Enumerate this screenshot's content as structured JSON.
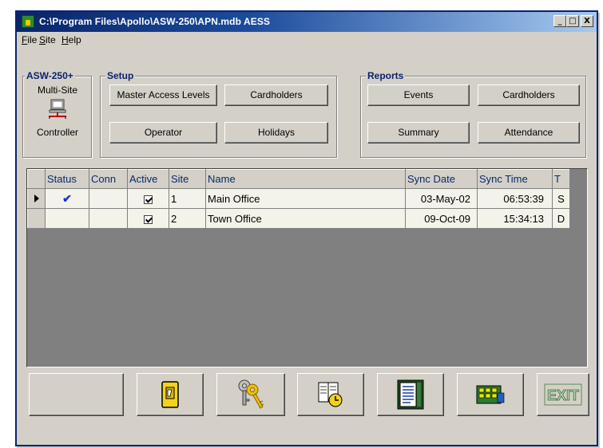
{
  "window": {
    "title": "C:\\Program Files\\Apollo\\ASW-250\\APN.mdb  AESS",
    "minimize": "_",
    "maximize": "□",
    "close": "X"
  },
  "menu": {
    "items": [
      {
        "label": "File",
        "accel": "F",
        "rest": "ile"
      },
      {
        "label": "Site",
        "accel": "S",
        "rest": "ite"
      },
      {
        "label": "Help",
        "accel": "H",
        "rest": "elp"
      }
    ]
  },
  "asw": {
    "title": "ASW-250+",
    "line1": "Multi-Site",
    "line2": "Controller",
    "icon": "computer-network-icon"
  },
  "setup": {
    "title": "Setup",
    "buttons": {
      "master_access_levels": "Master Access Levels",
      "cardholders": "Cardholders",
      "operator": "Operator",
      "holidays": "Holidays"
    }
  },
  "reports": {
    "title": "Reports",
    "buttons": {
      "events": "Events",
      "cardholders": "Cardholders",
      "summary": "Summary",
      "attendance": "Attendance"
    }
  },
  "grid": {
    "columns": [
      "Status",
      "Conn",
      "Active",
      "Site",
      "Name",
      "Sync Date",
      "Sync Time",
      "T"
    ],
    "rows": [
      {
        "status": "✔",
        "conn": "",
        "active": true,
        "site": "1",
        "name": "Main Office",
        "sync_date": "03-May-02",
        "sync_time": "06:53:39",
        "t": "S"
      },
      {
        "status": "",
        "conn": "",
        "active": true,
        "site": "2",
        "name": "Town Office",
        "sync_date": "09-Oct-09",
        "sync_time": "15:34:13",
        "t": "D"
      }
    ]
  },
  "toolbar": {
    "buttons": [
      {
        "name": "blank",
        "icon": ""
      },
      {
        "name": "door",
        "icon": "door-icon"
      },
      {
        "name": "keys",
        "icon": "keys-icon"
      },
      {
        "name": "schedule",
        "icon": "book-clock-icon"
      },
      {
        "name": "report",
        "icon": "report-icon"
      },
      {
        "name": "keypad",
        "icon": "keypad-icon"
      },
      {
        "name": "exit",
        "icon": "exit-sign-icon",
        "label": "EXIT"
      }
    ]
  },
  "colors": {
    "title_bar": "#0a246a",
    "face": "#d4d0c8",
    "grid_row": "#f3f3e9",
    "grid_empty": "#808080",
    "checkmark": "#1a2fd8"
  }
}
